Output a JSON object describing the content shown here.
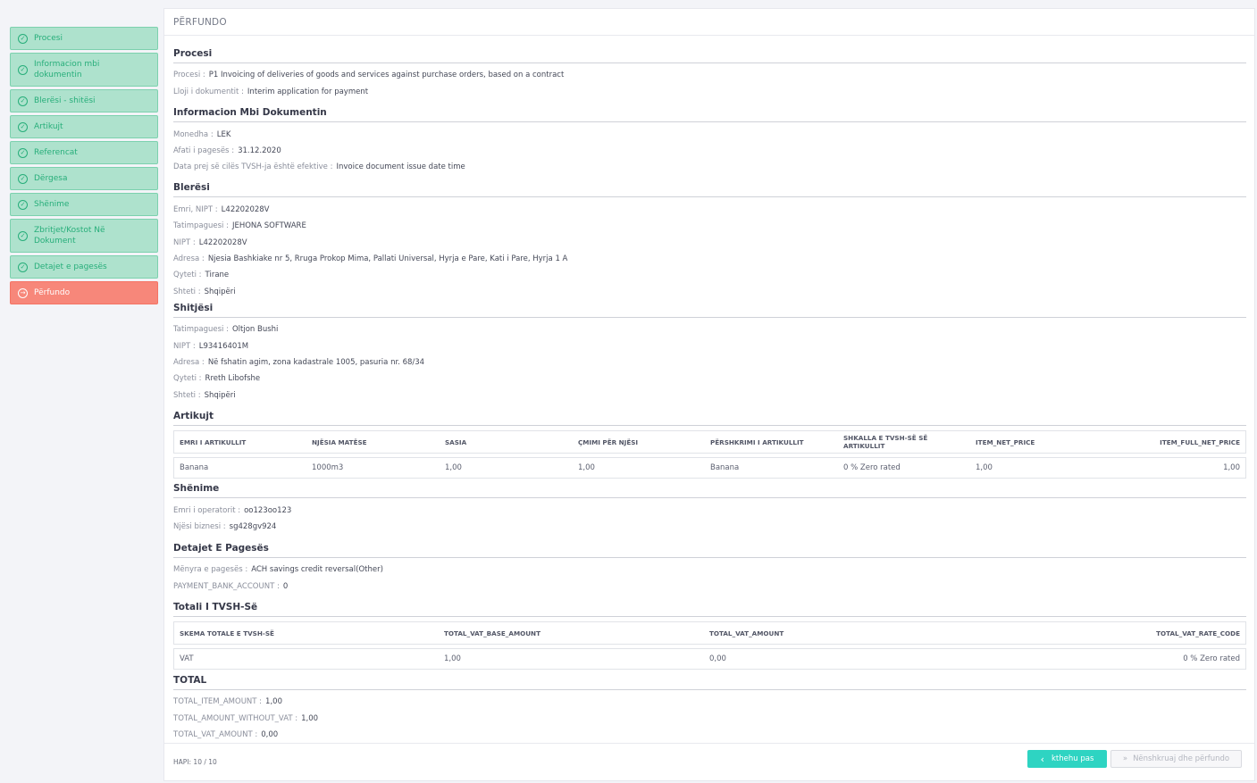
{
  "sidebar": {
    "steps": [
      {
        "label": "Procesi",
        "state": "done"
      },
      {
        "label": "Informacion mbi dokumentin",
        "state": "done"
      },
      {
        "label": "Blerësi - shitësi",
        "state": "done"
      },
      {
        "label": "Artikujt",
        "state": "done"
      },
      {
        "label": "Referencat",
        "state": "done"
      },
      {
        "label": "Dërgesa",
        "state": "done"
      },
      {
        "label": "Shënime",
        "state": "done"
      },
      {
        "label": "Zbritjet/Kostot Në Dokument",
        "state": "done"
      },
      {
        "label": "Detajet e pagesës",
        "state": "done"
      },
      {
        "label": "Përfundo",
        "state": "active"
      }
    ]
  },
  "panel": {
    "title": "PËRFUNDO"
  },
  "procesi": {
    "title": "Procesi",
    "process_key": "Procesi :",
    "process_val": "P1 Invoicing of deliveries of goods and services against purchase orders, based on a contract",
    "doctype_key": "Lloji i dokumentit :",
    "doctype_val": "Interim application for payment"
  },
  "info": {
    "title": "Informacion Mbi Dokumentin",
    "currency_key": "Monedha :",
    "currency_val": "LEK",
    "due_key": "Afati i pagesës :",
    "due_val": "31.12.2020",
    "vatdate_key": "Data prej së cilës TVSH-ja është efektive :",
    "vatdate_val": "Invoice document issue date time"
  },
  "buyer": {
    "title": "Blerësi",
    "name_key": "Emri, NIPT :",
    "name_val": "L42202028V",
    "taxpayer_key": "Tatimpaguesi :",
    "taxpayer_val": "JEHONA SOFTWARE",
    "nipt_key": "NIPT :",
    "nipt_val": "L42202028V",
    "address_key": "Adresa :",
    "address_val": "Njesia Bashkiake nr 5, Rruga Prokop Mima, Pallati Universal, Hyrja e Pare, Kati i Pare, Hyrja 1 A",
    "city_key": "Qyteti :",
    "city_val": "Tirane",
    "country_key": "Shteti :",
    "country_val": "Shqipëri"
  },
  "seller": {
    "title": "Shitjësi",
    "taxpayer_key": "Tatimpaguesi :",
    "taxpayer_val": "Oltjon Bushi",
    "nipt_key": "NIPT :",
    "nipt_val": "L93416401M",
    "address_key": "Adresa :",
    "address_val": "Në fshatin agim, zona kadastrale 1005, pasuria nr. 68/34",
    "city_key": "Qyteti :",
    "city_val": "Rreth Libofshe",
    "country_key": "Shteti :",
    "country_val": "Shqipëri"
  },
  "items": {
    "title": "Artikujt",
    "headers": [
      "EMRI I ARTIKULLIT",
      "NJËSIA MATËSE",
      "SASIA",
      "ÇMIMI PËR NJËSI",
      "PËRSHKRIMI I ARTIKULLIT",
      "SHKALLA E TVSH-SË SË ARTIKULLIT",
      "ITEM_NET_PRICE",
      "ITEM_FULL_NET_PRICE"
    ],
    "rows": [
      [
        "Banana",
        "1000m3",
        "1,00",
        "1,00",
        "Banana",
        "0 % Zero rated",
        "1,00",
        "1,00"
      ]
    ]
  },
  "notes": {
    "title": "Shënime",
    "operator_key": "Emri i operatorit :",
    "operator_val": "oo123oo123",
    "unit_key": "Njësi biznesi :",
    "unit_val": "sg428gv924"
  },
  "payment": {
    "title": "Detajet E Pagesës",
    "method_key": "Mënyra e pagesës :",
    "method_val": "ACH savings credit reversal(Other)",
    "account_key": "PAYMENT_BANK_ACCOUNT :",
    "account_val": "0"
  },
  "vat": {
    "title": "Totali I TVSH-Së",
    "headers": [
      "SKEMA TOTALE E TVSH-SË",
      "TOTAL_VAT_BASE_AMOUNT",
      "TOTAL_VAT_AMOUNT",
      "TOTAL_VAT_RATE_CODE"
    ],
    "rows": [
      [
        "VAT",
        "1,00",
        "0,00",
        "0 % Zero rated"
      ]
    ]
  },
  "total": {
    "title": "TOTAL",
    "item_key": "TOTAL_ITEM_AMOUNT :",
    "item_val": "1,00",
    "without_key": "TOTAL_AMOUNT_WITHOUT_VAT :",
    "without_val": "1,00",
    "vat_key": "TOTAL_VAT_AMOUNT :",
    "vat_val": "0,00"
  },
  "footer": {
    "step_counter": "HAPI: 10 / 10",
    "back_label": "kthehu pas",
    "sign_label": "Nënshkruaj dhe përfundo"
  },
  "colors": {
    "step_done_bg": "#aee2cd",
    "step_active_bg": "#f7877a",
    "primary_button": "#2ed4c2"
  }
}
